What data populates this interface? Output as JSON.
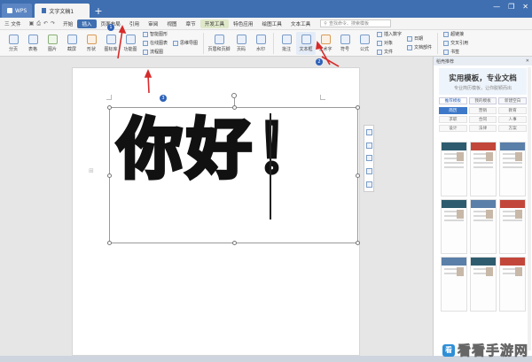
{
  "titlebar": {
    "app_tab": "WPS",
    "doc_tab": "文字文稿1",
    "new_tab": "+",
    "window_controls": [
      "—",
      "❐",
      "✕"
    ]
  },
  "menubar": {
    "file": "三 文件",
    "items": [
      "开始",
      "插入",
      "页面布局",
      "引用",
      "审阅",
      "视图",
      "章节",
      "开发工具",
      "特色应用",
      "绘图工具",
      "文本工具"
    ],
    "highlighted_index": 1,
    "tool_index": 7,
    "search_placeholder": "查找命令、搜索模板"
  },
  "ribbon": {
    "left_buttons": [
      "分页",
      "表格",
      "图片",
      "截屏",
      "形状",
      "图标库",
      "功能图"
    ],
    "group1": [
      "智能图形",
      "在线图表",
      "流程图",
      "思维导图"
    ],
    "mid_buttons": [
      "页眉和页脚",
      "页码",
      "水印"
    ],
    "right_buttons": [
      "批注",
      "文本框",
      "艺术字",
      "符号",
      "公式"
    ],
    "group2": [
      "插入数字",
      "对象",
      "文件"
    ],
    "group3": [
      "日期",
      "文档部件"
    ],
    "group4": [
      "超链接",
      "交叉引用",
      "书签"
    ]
  },
  "document": {
    "art_text": "你好！"
  },
  "markers": [
    "1",
    "2",
    "3"
  ],
  "sidepanel": {
    "header": "稻壳推荐",
    "banner_title": "实用模板，专业文档",
    "banner_sub": "专业简历模板，让你脱颖而出",
    "tabs": [
      "推荐模板",
      "我的模板",
      "新建空白"
    ],
    "tags": [
      "简历",
      "营销",
      "教育",
      "求职",
      "合同",
      "人事",
      "设计",
      "法律",
      "方案"
    ],
    "active_tag": 0
  },
  "watermark": {
    "logo": "看",
    "text": "看看手游网"
  },
  "colors": {
    "title_blue": "#3f6fb1",
    "marker_blue": "#2f62b8",
    "arrow_red": "#d62b2b"
  }
}
